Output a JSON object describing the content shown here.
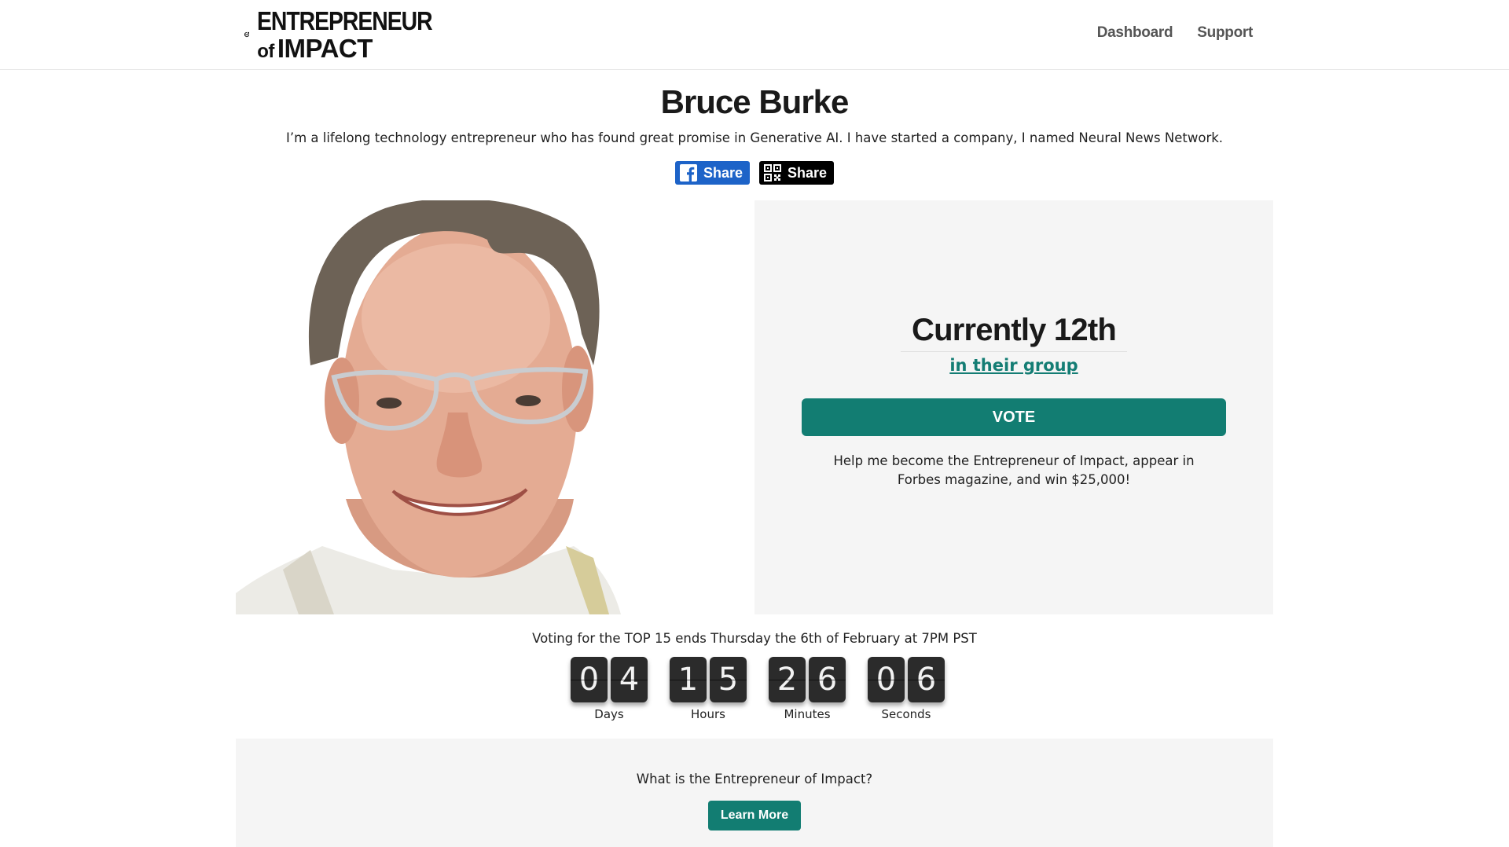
{
  "header": {
    "logo": {
      "line1": "ENTREPRENEUR",
      "line2_of": "of",
      "line2": "IMPACT"
    },
    "nav": [
      {
        "label": "Dashboard"
      },
      {
        "label": "Support"
      }
    ]
  },
  "profile": {
    "name": "Bruce Burke",
    "bio": "I’m a lifelong technology entrepreneur who has found great promise in Generative AI. I have started a company, I named Neural News Network.",
    "share_facebook": {
      "label": "Share",
      "icon": "facebook-icon",
      "color": "#1d63c8"
    },
    "share_qr": {
      "label": "Share",
      "icon": "qr-code-icon",
      "color": "#000000"
    },
    "photo": {
      "description_icon": "portrait-photo"
    }
  },
  "vote_panel": {
    "rank_text": "Currently 12th",
    "group_link": "in their group",
    "vote_label": "VOTE",
    "help_text": "Help me become the Entrepreneur of Impact, appear in Forbes magazine, and win $25,000!",
    "accent": "#127d72"
  },
  "countdown": {
    "deadline_text": "Voting for the TOP 15 ends Thursday the 6th of February at 7PM PST",
    "units": [
      {
        "digits": [
          "0",
          "4"
        ],
        "label": "Days"
      },
      {
        "digits": [
          "1",
          "5"
        ],
        "label": "Hours"
      },
      {
        "digits": [
          "2",
          "6"
        ],
        "label": "Minutes"
      },
      {
        "digits": [
          "0",
          "6"
        ],
        "label": "Seconds"
      }
    ]
  },
  "learn_more": {
    "question": "What is the Entrepreneur of Impact?",
    "button_label": "Learn More"
  }
}
